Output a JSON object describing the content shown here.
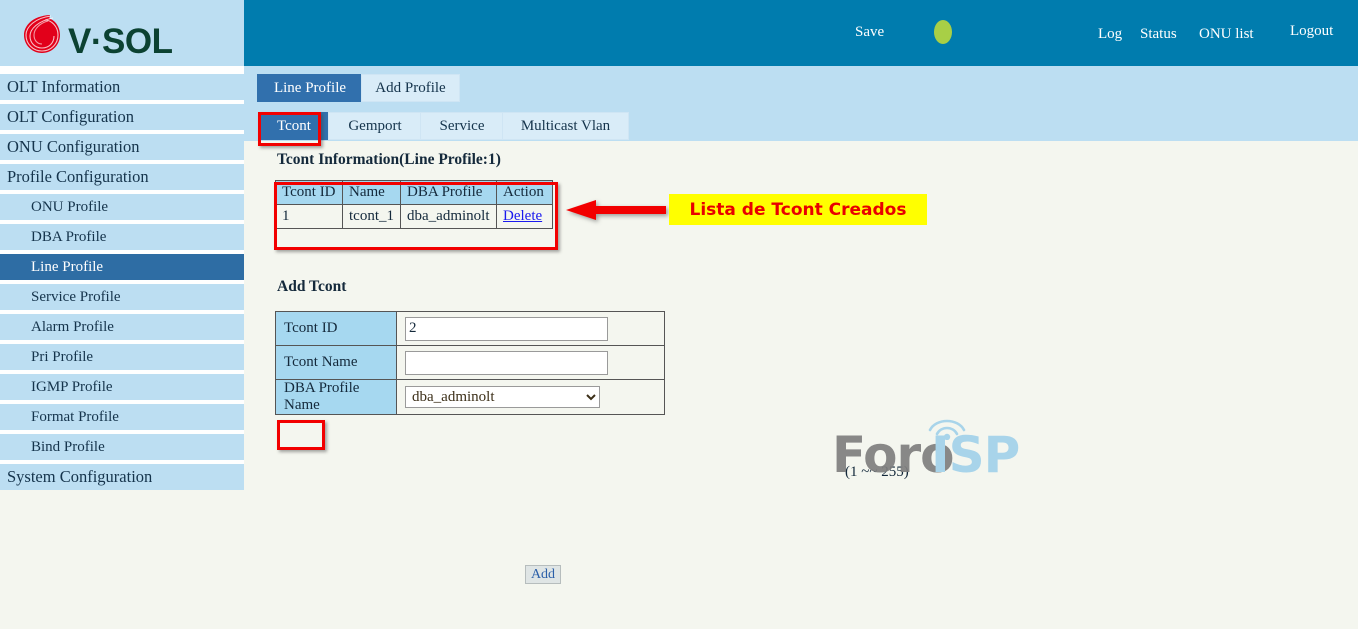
{
  "brand": {
    "name": "V·SOL",
    "logo_icon": "vsol-swirl-logo-icon",
    "logo_red": "#e2001a",
    "text_color": "#0c4232"
  },
  "header": {
    "background": "#007cae",
    "save_label": "Save",
    "indicator_icon": "status-dot-icon",
    "indicator_color": "#a8cf46",
    "log_label": "Log",
    "status_label": "Status",
    "onu_list_label": "ONU list",
    "logout_label": "Logout"
  },
  "sidebar": {
    "background": "#bcdef2",
    "active_color": "#2e6da4",
    "items": [
      {
        "label": "OLT Information",
        "level": 0,
        "active": false
      },
      {
        "label": "OLT Configuration",
        "level": 0,
        "active": false
      },
      {
        "label": "ONU Configuration",
        "level": 0,
        "active": false
      },
      {
        "label": "Profile Configuration",
        "level": 0,
        "active": false
      },
      {
        "label": "ONU Profile",
        "level": 1,
        "active": false
      },
      {
        "label": "DBA Profile",
        "level": 1,
        "active": false
      },
      {
        "label": "Line Profile",
        "level": 1,
        "active": true
      },
      {
        "label": "Service Profile",
        "level": 1,
        "active": false
      },
      {
        "label": "Alarm Profile",
        "level": 1,
        "active": false
      },
      {
        "label": "Pri Profile",
        "level": 1,
        "active": false
      },
      {
        "label": "IGMP Profile",
        "level": 1,
        "active": false
      },
      {
        "label": "Format Profile",
        "level": 1,
        "active": false
      },
      {
        "label": "Bind Profile",
        "level": 1,
        "active": false
      },
      {
        "label": "System Configuration",
        "level": 0,
        "active": false
      }
    ]
  },
  "tabs": {
    "primary": [
      {
        "label": "Line Profile",
        "active": true
      },
      {
        "label": "Add Profile",
        "active": false
      }
    ],
    "secondary": [
      {
        "label": "Tcont",
        "active": true
      },
      {
        "label": "Gemport",
        "active": false
      },
      {
        "label": "Service",
        "active": false
      },
      {
        "label": "Multicast Vlan",
        "active": false
      }
    ]
  },
  "info_section": {
    "title": "Tcont Information(Line Profile:1)",
    "columns": [
      "Tcont ID",
      "Name",
      "DBA Profile",
      "Action"
    ],
    "rows": [
      {
        "tcont_id": "1",
        "name": "tcont_1",
        "dba_profile": "dba_adminolt",
        "action": "Delete"
      }
    ]
  },
  "annotation": {
    "text": "Lista de Tcont Creados",
    "background": "#ffff00",
    "text_color": "#e80000",
    "arrow_color": "#f20000",
    "arrow_icon": "left-arrow-icon"
  },
  "add_section": {
    "title": "Add Tcont",
    "fields": {
      "tcont_id_label": "Tcont ID",
      "tcont_id_value": "2",
      "tcont_id_hint": "(1 ~~ 255)",
      "tcont_name_label": "Tcont Name",
      "tcont_name_value": "",
      "tcont_name_placeholder": "",
      "dba_profile_label": "DBA Profile Name",
      "dba_profile_selected": "dba_adminolt",
      "dba_profile_options": [
        "dba_adminolt"
      ]
    },
    "add_button_label": "Add"
  },
  "watermark": {
    "part1": "Foro",
    "part2": "ISP",
    "part1_color": "#7f7f7f",
    "part2_color": "#a8d4ea",
    "signal_icon": "wifi-signal-icon"
  }
}
